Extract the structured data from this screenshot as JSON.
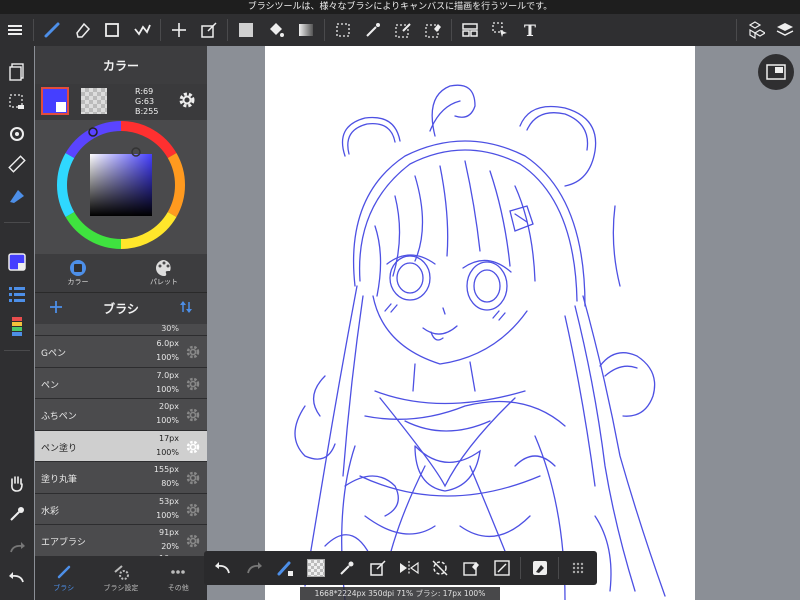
{
  "tip_bar": {
    "text": "ブラシツールは、様々なブラシによりキャンバスに描画を行うツールです。"
  },
  "toolbar": {
    "items": [
      "menu-icon",
      "brush-icon",
      "eraser-icon",
      "shape-icon",
      "fill-blur-icon",
      "move-icon",
      "transform-icon",
      "fill-color-icon",
      "bucket-icon",
      "gradient-icon",
      "select-icon",
      "magic-wand-icon",
      "select-pen-icon",
      "select-eraser-icon",
      "layout-icon",
      "select-move-icon",
      "text-icon",
      "3d-model-icon",
      "layers-icon"
    ],
    "text_tool_label": "T"
  },
  "color_panel": {
    "title": "カラー",
    "r": "R:69",
    "g": "G:63",
    "b": "B:255",
    "main_color": "#453fff",
    "tab_color": "カラー",
    "tab_palette": "パレット"
  },
  "brush_panel": {
    "title": "ブラシ",
    "partial_top": "30%",
    "brushes": [
      {
        "name": "Gペン",
        "size": "6.0px",
        "opacity": "100%"
      },
      {
        "name": "ペン",
        "size": "7.0px",
        "opacity": "100%"
      },
      {
        "name": "ふちペン",
        "size": "20px",
        "opacity": "100%"
      },
      {
        "name": "ペン塗り",
        "size": "17px",
        "opacity": "100%",
        "selected": true
      },
      {
        "name": "塗り丸筆",
        "size": "155px",
        "opacity": "80%"
      },
      {
        "name": "水彩",
        "size": "53px",
        "opacity": "100%"
      },
      {
        "name": "エアブラシ",
        "size": "91px",
        "opacity": "20%"
      }
    ],
    "partial_bottom": "10px",
    "tab_brush": "ブラシ",
    "tab_brush_settings": "ブラシ設定",
    "tab_other": "その他"
  },
  "status": {
    "text": "1668*2224px 350dpi 71% ブラシ: 17px 100%"
  },
  "colors": {
    "accent": "#4d8fe8",
    "sketch": "#3a3ee0",
    "toolbar_bg": "#2f2f31",
    "canvas_bg": "#8b8f96"
  }
}
